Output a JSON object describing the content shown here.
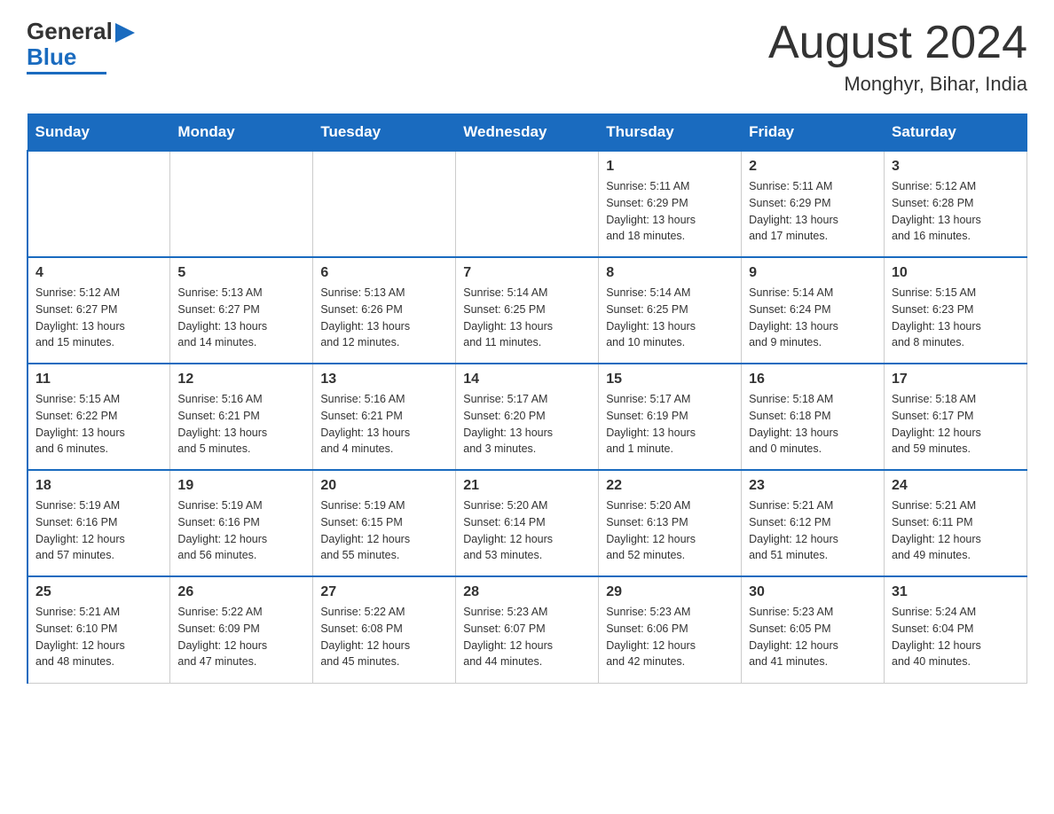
{
  "header": {
    "logo_general": "General",
    "logo_blue": "Blue",
    "title": "August 2024",
    "subtitle": "Monghyr, Bihar, India"
  },
  "days_of_week": [
    "Sunday",
    "Monday",
    "Tuesday",
    "Wednesday",
    "Thursday",
    "Friday",
    "Saturday"
  ],
  "weeks": [
    [
      {
        "day": "",
        "info": ""
      },
      {
        "day": "",
        "info": ""
      },
      {
        "day": "",
        "info": ""
      },
      {
        "day": "",
        "info": ""
      },
      {
        "day": "1",
        "info": "Sunrise: 5:11 AM\nSunset: 6:29 PM\nDaylight: 13 hours\nand 18 minutes."
      },
      {
        "day": "2",
        "info": "Sunrise: 5:11 AM\nSunset: 6:29 PM\nDaylight: 13 hours\nand 17 minutes."
      },
      {
        "day": "3",
        "info": "Sunrise: 5:12 AM\nSunset: 6:28 PM\nDaylight: 13 hours\nand 16 minutes."
      }
    ],
    [
      {
        "day": "4",
        "info": "Sunrise: 5:12 AM\nSunset: 6:27 PM\nDaylight: 13 hours\nand 15 minutes."
      },
      {
        "day": "5",
        "info": "Sunrise: 5:13 AM\nSunset: 6:27 PM\nDaylight: 13 hours\nand 14 minutes."
      },
      {
        "day": "6",
        "info": "Sunrise: 5:13 AM\nSunset: 6:26 PM\nDaylight: 13 hours\nand 12 minutes."
      },
      {
        "day": "7",
        "info": "Sunrise: 5:14 AM\nSunset: 6:25 PM\nDaylight: 13 hours\nand 11 minutes."
      },
      {
        "day": "8",
        "info": "Sunrise: 5:14 AM\nSunset: 6:25 PM\nDaylight: 13 hours\nand 10 minutes."
      },
      {
        "day": "9",
        "info": "Sunrise: 5:14 AM\nSunset: 6:24 PM\nDaylight: 13 hours\nand 9 minutes."
      },
      {
        "day": "10",
        "info": "Sunrise: 5:15 AM\nSunset: 6:23 PM\nDaylight: 13 hours\nand 8 minutes."
      }
    ],
    [
      {
        "day": "11",
        "info": "Sunrise: 5:15 AM\nSunset: 6:22 PM\nDaylight: 13 hours\nand 6 minutes."
      },
      {
        "day": "12",
        "info": "Sunrise: 5:16 AM\nSunset: 6:21 PM\nDaylight: 13 hours\nand 5 minutes."
      },
      {
        "day": "13",
        "info": "Sunrise: 5:16 AM\nSunset: 6:21 PM\nDaylight: 13 hours\nand 4 minutes."
      },
      {
        "day": "14",
        "info": "Sunrise: 5:17 AM\nSunset: 6:20 PM\nDaylight: 13 hours\nand 3 minutes."
      },
      {
        "day": "15",
        "info": "Sunrise: 5:17 AM\nSunset: 6:19 PM\nDaylight: 13 hours\nand 1 minute."
      },
      {
        "day": "16",
        "info": "Sunrise: 5:18 AM\nSunset: 6:18 PM\nDaylight: 13 hours\nand 0 minutes."
      },
      {
        "day": "17",
        "info": "Sunrise: 5:18 AM\nSunset: 6:17 PM\nDaylight: 12 hours\nand 59 minutes."
      }
    ],
    [
      {
        "day": "18",
        "info": "Sunrise: 5:19 AM\nSunset: 6:16 PM\nDaylight: 12 hours\nand 57 minutes."
      },
      {
        "day": "19",
        "info": "Sunrise: 5:19 AM\nSunset: 6:16 PM\nDaylight: 12 hours\nand 56 minutes."
      },
      {
        "day": "20",
        "info": "Sunrise: 5:19 AM\nSunset: 6:15 PM\nDaylight: 12 hours\nand 55 minutes."
      },
      {
        "day": "21",
        "info": "Sunrise: 5:20 AM\nSunset: 6:14 PM\nDaylight: 12 hours\nand 53 minutes."
      },
      {
        "day": "22",
        "info": "Sunrise: 5:20 AM\nSunset: 6:13 PM\nDaylight: 12 hours\nand 52 minutes."
      },
      {
        "day": "23",
        "info": "Sunrise: 5:21 AM\nSunset: 6:12 PM\nDaylight: 12 hours\nand 51 minutes."
      },
      {
        "day": "24",
        "info": "Sunrise: 5:21 AM\nSunset: 6:11 PM\nDaylight: 12 hours\nand 49 minutes."
      }
    ],
    [
      {
        "day": "25",
        "info": "Sunrise: 5:21 AM\nSunset: 6:10 PM\nDaylight: 12 hours\nand 48 minutes."
      },
      {
        "day": "26",
        "info": "Sunrise: 5:22 AM\nSunset: 6:09 PM\nDaylight: 12 hours\nand 47 minutes."
      },
      {
        "day": "27",
        "info": "Sunrise: 5:22 AM\nSunset: 6:08 PM\nDaylight: 12 hours\nand 45 minutes."
      },
      {
        "day": "28",
        "info": "Sunrise: 5:23 AM\nSunset: 6:07 PM\nDaylight: 12 hours\nand 44 minutes."
      },
      {
        "day": "29",
        "info": "Sunrise: 5:23 AM\nSunset: 6:06 PM\nDaylight: 12 hours\nand 42 minutes."
      },
      {
        "day": "30",
        "info": "Sunrise: 5:23 AM\nSunset: 6:05 PM\nDaylight: 12 hours\nand 41 minutes."
      },
      {
        "day": "31",
        "info": "Sunrise: 5:24 AM\nSunset: 6:04 PM\nDaylight: 12 hours\nand 40 minutes."
      }
    ]
  ]
}
